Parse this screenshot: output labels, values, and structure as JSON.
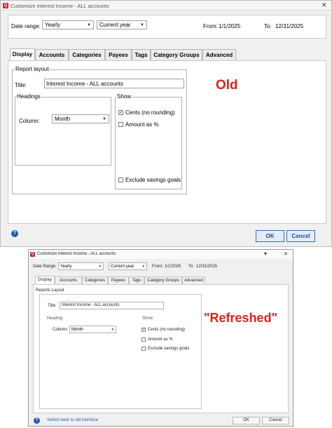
{
  "old": {
    "window_title": "Customize Interest Income - ALL accounts",
    "app_icon_letter": "Q",
    "close_glyph": "✕",
    "date_range_label": "Date range:",
    "date_range_value": "Yearly",
    "period_value": "Current year",
    "from_label": "From:",
    "from_value": "1/1/2025",
    "to_label": "To:",
    "to_value": "12/31/2025",
    "tabs": [
      "Display",
      "Accounts",
      "Categories",
      "Payees",
      "Tags",
      "Category Groups",
      "Advanced"
    ],
    "report_layout_label": "Report layout",
    "title_label": "Title:",
    "title_value": "Interest Income - ALL accounts",
    "headings_label": "Headings",
    "column_label": "Column:",
    "column_value": "Month",
    "show_label": "Show",
    "cents_label": "Cents (no rounding)",
    "amount_pct_label": "Amount as %",
    "exclude_savings_label": "Exclude savings goals",
    "ok_label": "OK",
    "cancel_label": "Cancel",
    "help_glyph": "?",
    "caption": "Old"
  },
  "new": {
    "window_title": "Customize Interest Income - ALL accounts",
    "app_icon_letter": "Q",
    "minimize_glyph": "▾",
    "close_glyph": "✕",
    "date_range_label": "Date Range:",
    "date_range_value": "Yearly",
    "period_value": "Current year",
    "from_label": "From:",
    "from_value": "1/1/2025",
    "to_label": "To:",
    "to_value": "12/31/2025",
    "tabs": [
      "Display",
      "Accounts",
      "Categories",
      "Payees",
      "Tags",
      "Category Groups",
      "Advanced"
    ],
    "reports_layout_label": "Reports Layout",
    "title_label": "Title:",
    "title_value": "Interest Income - ALL accounts",
    "heading_label": "Heading",
    "column_label": "Column:",
    "column_value": "Month",
    "show_label": "Show",
    "cents_label": "Cents (no rounding)",
    "amount_pct_label": "Amount as %",
    "exclude_savings_label": "Exclude savings goals",
    "switch_link": "Switch back to old interface",
    "ok_label": "OK",
    "cancel_label": "Cancel",
    "help_glyph": "?",
    "caption": "\"Refreshed\""
  },
  "colors": {
    "caption_red": "#e0201c",
    "brand_red": "#c8202b",
    "help_blue": "#1f5fb0",
    "ok_blue": "#2f6fb5"
  },
  "checkbox_states": {
    "old_cents": true,
    "old_amount_pct": false,
    "old_exclude_savings": false,
    "new_cents": true,
    "new_amount_pct": false,
    "new_exclude_savings": false
  }
}
